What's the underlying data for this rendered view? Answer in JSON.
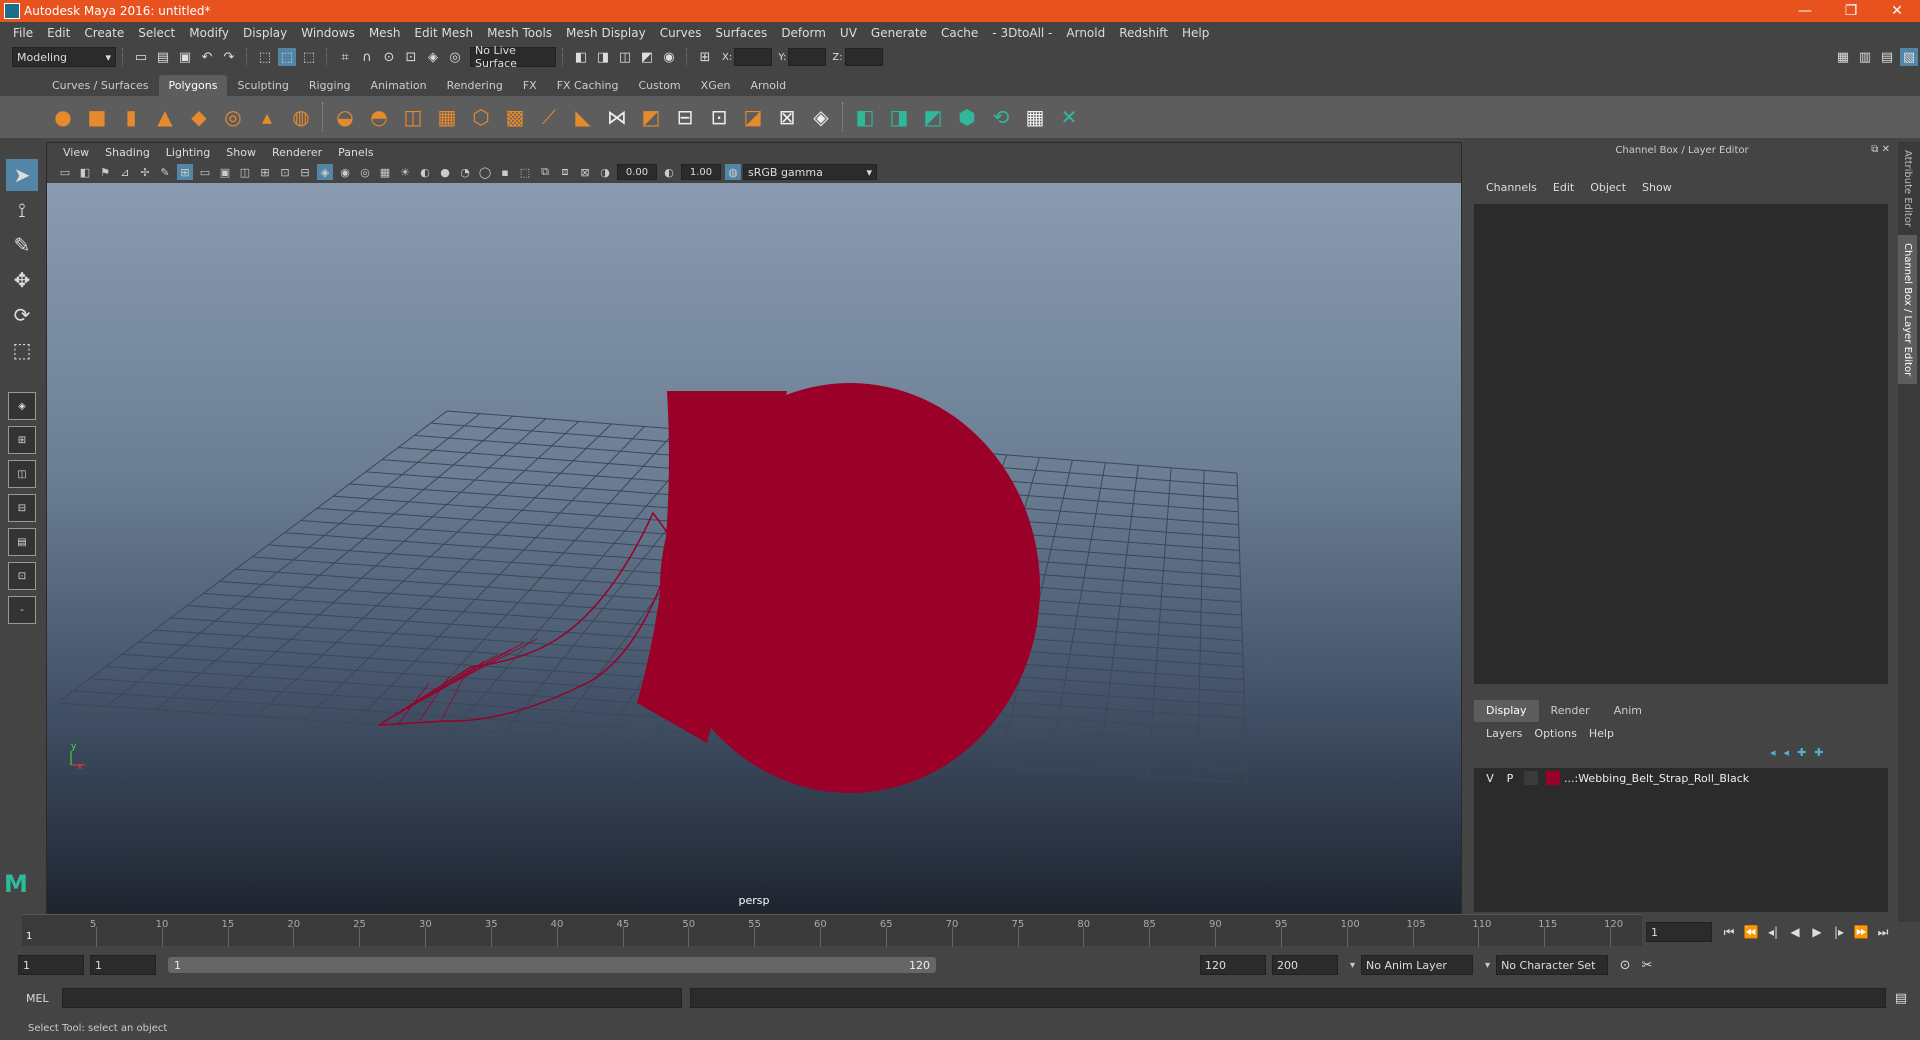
{
  "window": {
    "title": "Autodesk Maya 2016: untitled*",
    "controls": [
      "—",
      "❐",
      "✕"
    ]
  },
  "menubar": [
    "File",
    "Edit",
    "Create",
    "Select",
    "Modify",
    "Display",
    "Windows",
    "Mesh",
    "Edit Mesh",
    "Mesh Tools",
    "Mesh Display",
    "Curves",
    "Surfaces",
    "Deform",
    "UV",
    "Generate",
    "Cache",
    "- 3DtoAll -",
    "Arnold",
    "Redshift",
    "Help"
  ],
  "statusline": {
    "menuset": "Modeling",
    "live_surface": "No Live Surface",
    "x_label": "X:",
    "y_label": "Y:",
    "z_label": "Z:"
  },
  "shelf": {
    "tabs": [
      "Curves / Surfaces",
      "Polygons",
      "Sculpting",
      "Rigging",
      "Animation",
      "Rendering",
      "FX",
      "FX Caching",
      "Custom",
      "XGen",
      "Arnold"
    ],
    "active_tab": "Polygons"
  },
  "viewport": {
    "menus": [
      "View",
      "Shading",
      "Lighting",
      "Show",
      "Renderer",
      "Panels"
    ],
    "exposure": "0.00",
    "gamma": "1.00",
    "color_space": "sRGB gamma",
    "camera": "persp",
    "axis_x": "x",
    "axis_y": "y",
    "model_color": "#9a0028",
    "sky_top": "#8a9bb0"
  },
  "channel_box": {
    "header": "Channel Box / Layer Editor",
    "menus": [
      "Channels",
      "Edit",
      "Object",
      "Show"
    ],
    "layer_tabs": [
      "Display",
      "Render",
      "Anim"
    ],
    "layer_menus": [
      "Layers",
      "Options",
      "Help"
    ],
    "layers": [
      {
        "v": "V",
        "p": "P",
        "name": "...:Webbing_Belt_Strap_Roll_Black",
        "color": "#9a0028"
      }
    ]
  },
  "side_tabs": [
    "Attribute Editor",
    "Channel Box / Layer Editor"
  ],
  "timeline": {
    "ticks": [
      "5",
      "10",
      "15",
      "20",
      "25",
      "30",
      "35",
      "40",
      "45",
      "50",
      "55",
      "60",
      "65",
      "70",
      "75",
      "80",
      "85",
      "90",
      "95",
      "100",
      "105",
      "110",
      "115",
      "120"
    ],
    "start_marker": "1",
    "current_frame": "1"
  },
  "range": {
    "start": "1",
    "inner_start": "1",
    "slider_start": "1",
    "slider_end": "120",
    "end": "120",
    "anim_end": "200",
    "anim_layer": "No Anim Layer",
    "char_set": "No Character Set"
  },
  "mel": {
    "label": "MEL"
  },
  "help_line": "Select Tool: select an object"
}
